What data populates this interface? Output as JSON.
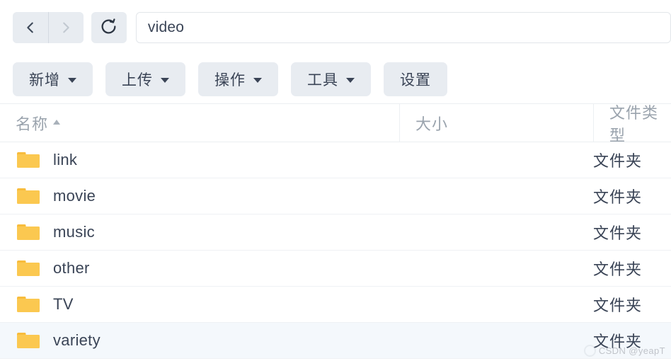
{
  "nav": {
    "back_icon": "chevron-left-icon",
    "forward_icon": "chevron-right-icon",
    "reload_icon": "reload-icon",
    "back_enabled": true,
    "forward_enabled": false,
    "address_value": "video",
    "address_placeholder": "video"
  },
  "toolbar": {
    "buttons": [
      {
        "label": "新增",
        "has_caret": true
      },
      {
        "label": "上传",
        "has_caret": true
      },
      {
        "label": "操作",
        "has_caret": true
      },
      {
        "label": "工具",
        "has_caret": true
      },
      {
        "label": "设置",
        "has_caret": false
      }
    ]
  },
  "table": {
    "columns": [
      {
        "label": "名称",
        "sort": "asc"
      },
      {
        "label": "大小",
        "sort": "none"
      },
      {
        "label": "文件类型",
        "sort": "none"
      }
    ],
    "rows": [
      {
        "icon": "folder-icon",
        "name": "link",
        "size": "",
        "type": "文件夹",
        "highlight": false
      },
      {
        "icon": "folder-icon",
        "name": "movie",
        "size": "",
        "type": "文件夹",
        "highlight": false
      },
      {
        "icon": "folder-icon",
        "name": "music",
        "size": "",
        "type": "文件夹",
        "highlight": false
      },
      {
        "icon": "folder-icon",
        "name": "other",
        "size": "",
        "type": "文件夹",
        "highlight": false
      },
      {
        "icon": "folder-icon",
        "name": "TV",
        "size": "",
        "type": "文件夹",
        "highlight": false
      },
      {
        "icon": "folder-icon",
        "name": "variety",
        "size": "",
        "type": "文件夹",
        "highlight": true
      }
    ]
  },
  "watermark": {
    "text": "CSDN @yeapT"
  },
  "colors": {
    "folder": "#fbc850",
    "folder_dark": "#f8bc3c",
    "button_bg": "#e8ecf1",
    "text": "#3a4456",
    "muted": "#9aa3ad",
    "row_highlight": "#f4f8fc",
    "border": "#eceff2"
  }
}
